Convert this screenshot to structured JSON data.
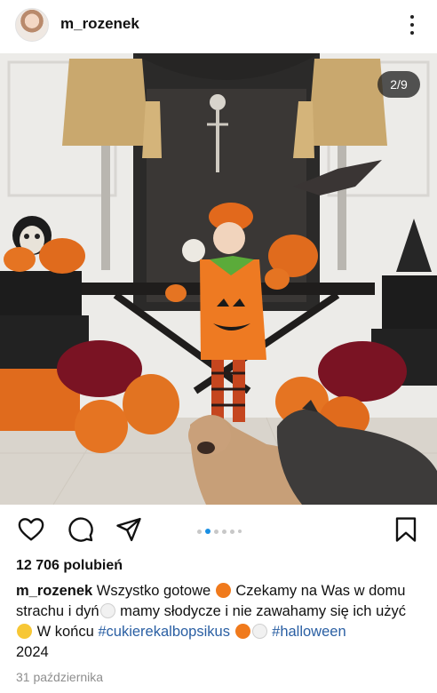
{
  "header": {
    "username": "m_rozenek",
    "avatar_icon": "profile-avatar",
    "more_icon": "more-vertical-icon"
  },
  "post": {
    "slide_counter": "2/9",
    "carousel": {
      "total": 6,
      "active": 1
    }
  },
  "actions": {
    "like_icon": "heart-icon",
    "comment_icon": "comment-icon",
    "share_icon": "send-icon",
    "save_icon": "bookmark-icon"
  },
  "likes_text": "12 706 polubień",
  "caption": {
    "user": "m_rozenek",
    "part1": " Wszystko gotowe ",
    "emoji_pumpkin": "pumpkin-emoji",
    "part2": " Czekamy na Was w domu strachu i dyń",
    "emoji_ghost": "ghost-emoji",
    "part3": " mamy słodycze i nie zawahamy się ich użyć ",
    "emoji_laugh": "laughing-emoji",
    "part4": " W końcu ",
    "hashtag1": "#cukierekalbopsikus",
    "hashtag2": "#halloween",
    "part5": "2024"
  },
  "date": "31 października",
  "colors": {
    "accent_blue": "#1a8fe3",
    "hashtag": "#2a5fa3",
    "muted": "#8e8e8e"
  }
}
